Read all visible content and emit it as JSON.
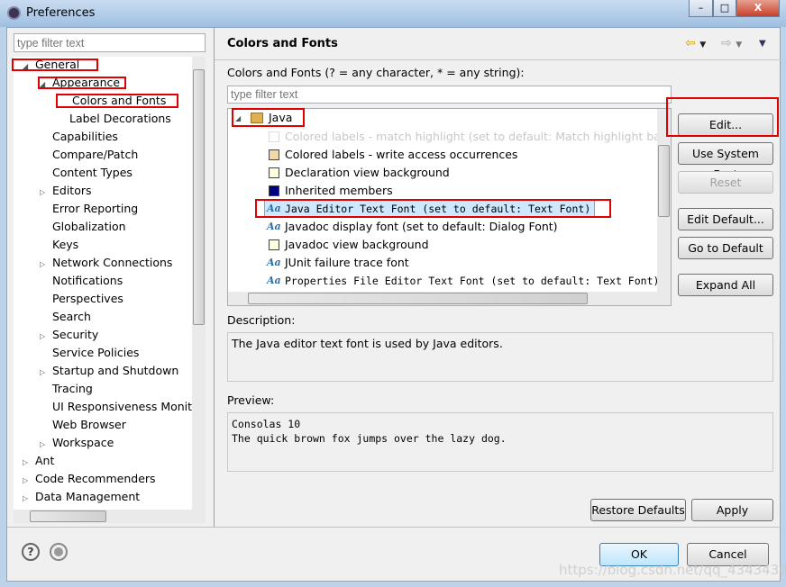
{
  "window": {
    "title": "Preferences",
    "min": "–",
    "max": "□",
    "close": "X"
  },
  "left": {
    "filter_placeholder": "type filter text",
    "tree": [
      {
        "label": "General",
        "level": 0,
        "exp": "open"
      },
      {
        "label": "Appearance",
        "level": 1,
        "exp": "open"
      },
      {
        "label": "Colors and Fonts",
        "level": 2,
        "exp": "",
        "selected": true
      },
      {
        "label": "Label Decorations",
        "level": 2,
        "exp": ""
      },
      {
        "label": "Capabilities",
        "level": 1,
        "exp": ""
      },
      {
        "label": "Compare/Patch",
        "level": 1,
        "exp": ""
      },
      {
        "label": "Content Types",
        "level": 1,
        "exp": ""
      },
      {
        "label": "Editors",
        "level": 1,
        "exp": "closed"
      },
      {
        "label": "Error Reporting",
        "level": 1,
        "exp": ""
      },
      {
        "label": "Globalization",
        "level": 1,
        "exp": ""
      },
      {
        "label": "Keys",
        "level": 1,
        "exp": ""
      },
      {
        "label": "Network Connections",
        "level": 1,
        "exp": "closed"
      },
      {
        "label": "Notifications",
        "level": 1,
        "exp": ""
      },
      {
        "label": "Perspectives",
        "level": 1,
        "exp": ""
      },
      {
        "label": "Search",
        "level": 1,
        "exp": ""
      },
      {
        "label": "Security",
        "level": 1,
        "exp": "closed"
      },
      {
        "label": "Service Policies",
        "level": 1,
        "exp": ""
      },
      {
        "label": "Startup and Shutdown",
        "level": 1,
        "exp": "closed"
      },
      {
        "label": "Tracing",
        "level": 1,
        "exp": ""
      },
      {
        "label": "UI Responsiveness Monitoring",
        "level": 1,
        "exp": ""
      },
      {
        "label": "Web Browser",
        "level": 1,
        "exp": ""
      },
      {
        "label": "Workspace",
        "level": 1,
        "exp": "closed"
      },
      {
        "label": "Ant",
        "level": 0,
        "exp": "closed"
      },
      {
        "label": "Code Recommenders",
        "level": 0,
        "exp": "closed"
      },
      {
        "label": "Data Management",
        "level": 0,
        "exp": "closed"
      }
    ]
  },
  "right": {
    "header": "Colors and Fonts",
    "intro": "Colors and Fonts (? = any character, * = any string):",
    "filter_placeholder": "type filter text",
    "group": "Java",
    "items": [
      {
        "label": "Colored labels - match highlight (set to default: Match highlight background)",
        "icon": "swatch",
        "color": "#ffffff",
        "disabled": true
      },
      {
        "label": "Colored labels - write access occurrences",
        "icon": "swatch",
        "color": "#f0d8a8"
      },
      {
        "label": "Declaration view background",
        "icon": "swatch",
        "color": "#fdfde0"
      },
      {
        "label": "Inherited members",
        "icon": "swatch",
        "color": "#000080"
      },
      {
        "label": "Java Editor Text Font (set to default: Text Font)",
        "icon": "font",
        "mono": true,
        "selected": true
      },
      {
        "label": "Javadoc display font (set to default: Dialog Font)",
        "icon": "font"
      },
      {
        "label": "Javadoc view background",
        "icon": "swatch",
        "color": "#fdfde0"
      },
      {
        "label": "JUnit failure trace font",
        "icon": "font"
      },
      {
        "label": "Properties File Editor Text Font (set to default: Text Font)",
        "icon": "font",
        "mono": true
      }
    ],
    "buttons": {
      "edit": "Edit...",
      "system": "Use System Font",
      "reset": "Reset",
      "edit_default": "Edit Default...",
      "go_default": "Go to Default",
      "expand": "Expand All"
    },
    "description_label": "Description:",
    "description": "The Java editor text font is used by Java editors.",
    "preview_label": "Preview:",
    "preview_line1": "Consolas 10",
    "preview_line2": "The quick brown fox jumps over the lazy dog.",
    "restore": "Restore Defaults",
    "apply": "Apply"
  },
  "footer": {
    "ok": "OK",
    "cancel": "Cancel",
    "help": "?"
  },
  "watermark": "https://blog.csdn.net/qq_43434300",
  "colors": {
    "highlight": "#e00000",
    "selection": "#cde8ff"
  }
}
